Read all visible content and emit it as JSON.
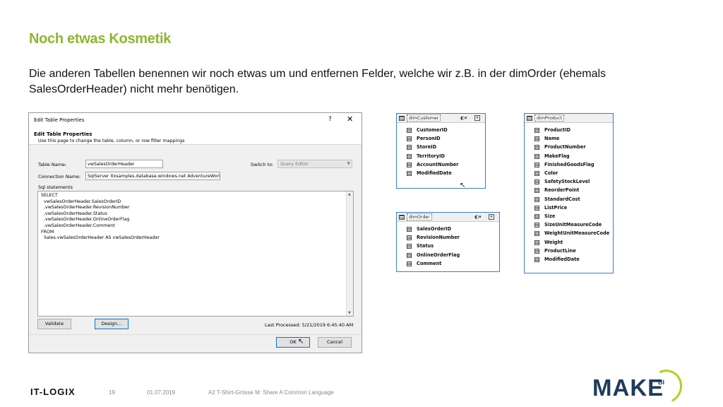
{
  "slide": {
    "title": "Noch etwas Kosmetik",
    "text": "Die anderen Tabellen benennen wir noch etwas um und entfernen Felder, welche wir z.B. in der dimOrder (ehemals SalesOrderHeader) nicht mehr benötigen."
  },
  "dialog": {
    "window_title": "Edit Table Properties",
    "help_glyph": "?",
    "close_glyph": "✕",
    "heading": "Edit Table Properties",
    "description": "Use this page to change the table, column, or row filter mappings",
    "table_name_label": "Table Name:",
    "table_name_value": "vwSalesOrderHeader",
    "switch_to_label": "Switch to:",
    "switch_to_value": "Query Editor",
    "connection_name_label": "Connection Name:",
    "connection_name_value": "SqlServer itxsamples.database.windows.net AdventureWorks",
    "sql_label": "Sql statements",
    "sql_lines": [
      "SELECT",
      "  vwSalesOrderHeader.SalesOrderID",
      "  ,vwSalesOrderHeader.RevisionNumber",
      "  ,vwSalesOrderHeader.Status",
      "  ,vwSalesOrderHeader.OnlineOrderFlag",
      "  ,vwSalesOrderHeader.Comment",
      "FROM",
      "  Sales.vwSalesOrderHeader AS vwSalesOrderHeader"
    ],
    "validate_label": "Validate",
    "design_label": "Design...",
    "last_processed": "Last Processed: 5/21/2019 6:45:40 AM",
    "ok_label": "OK",
    "cancel_label": "Cancel"
  },
  "tables": {
    "dimCustomer": {
      "name": "dimCustomer",
      "columns": [
        "CustomerID",
        "PersonID",
        "StoreID",
        "TerritoryID",
        "AccountNumber",
        "ModifiedDate"
      ]
    },
    "dimProduct": {
      "name": "dimProduct",
      "columns": [
        "ProductID",
        "Name",
        "ProductNumber",
        "MakeFlag",
        "FinishedGoodsFlag",
        "Color",
        "SafetyStockLevel",
        "ReorderPoint",
        "StandardCost",
        "ListPrice",
        "Size",
        "SizeUnitMeasureCode",
        "WeightUnitMeasureCode",
        "Weight",
        "ProductLine",
        "ModifiedDate"
      ]
    },
    "dimOrder": {
      "name": "dimOrder",
      "columns": [
        "SalesOrderID",
        "RevisionNumber",
        "Status",
        "OnlineOrderFlag",
        "Comment"
      ]
    }
  },
  "footer": {
    "company": "IT-LOGIX",
    "page": "19",
    "date": "01.07.2019",
    "title": "A2 T-Shirt-Grösse M: Share A Common Language",
    "brand": "MAKE",
    "brand_sup": "BI"
  },
  "colors": {
    "title_green": "#8db62d",
    "table_border_blue": "#3d7bd0",
    "brand_navy": "#1f3b5b",
    "brand_lime": "#b5cf1e"
  }
}
